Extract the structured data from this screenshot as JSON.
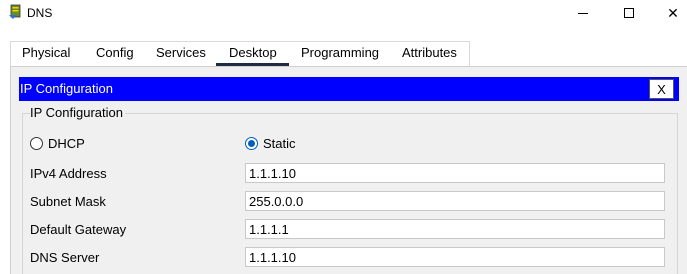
{
  "window": {
    "title": "DNS",
    "app_icon": "server-icon",
    "controls": {
      "minimize": "minimize-icon",
      "maximize": "maximize-icon",
      "close": "✕"
    }
  },
  "tabs": [
    {
      "label": "Physical"
    },
    {
      "label": "Config"
    },
    {
      "label": "Services"
    },
    {
      "label": "Desktop",
      "active": true
    },
    {
      "label": "Programming"
    },
    {
      "label": "Attributes"
    }
  ],
  "ip_config": {
    "header_title": "IP Configuration",
    "close_label": "X",
    "group_title": "IP Configuration",
    "mode": {
      "dhcp_label": "DHCP",
      "static_label": "Static",
      "selected": "Static"
    },
    "fields": [
      {
        "label": "IPv4 Address",
        "value": "1.1.1.10"
      },
      {
        "label": "Subnet Mask",
        "value": "255.0.0.0"
      },
      {
        "label": "Default Gateway",
        "value": "1.1.1.1"
      },
      {
        "label": "DNS Server",
        "value": "1.1.1.10"
      }
    ]
  },
  "colors": {
    "header_bg": "#0000ff",
    "header_text": "#ffffff",
    "radio_selected": "#005fb8",
    "panel_bg": "#f0f0f0"
  }
}
